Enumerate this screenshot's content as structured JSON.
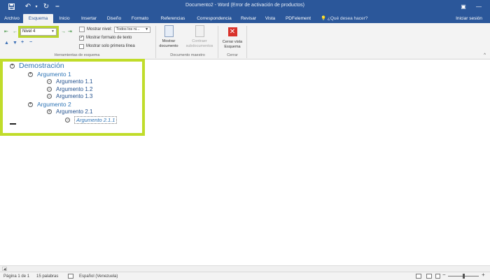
{
  "titlebar": {
    "title": "Documento2 - Word (Error de activación de productos)",
    "save_icon": "save-icon",
    "undo_icon": "undo-icon",
    "redo_icon": "redo-icon"
  },
  "tabs": [
    {
      "label": "Archivo"
    },
    {
      "label": "Esquema",
      "active": true
    },
    {
      "label": "Inicio"
    },
    {
      "label": "Insertar"
    },
    {
      "label": "Diseño"
    },
    {
      "label": "Formato"
    },
    {
      "label": "Referencias"
    },
    {
      "label": "Correspondencia"
    },
    {
      "label": "Revisar"
    },
    {
      "label": "Vista"
    },
    {
      "label": "PDFelement"
    }
  ],
  "tell_me": "¿Qué desea hacer?",
  "sign_in": "Iniciar sesión",
  "ribbon": {
    "outline_tools": {
      "level_value": "Nivel 4",
      "show_level_label": "Mostrar nivel:",
      "show_level_value": "Todos los ni...",
      "show_text_formatting": "Mostrar formato de texto",
      "show_text_formatting_checked": true,
      "show_first_line_only": "Mostrar solo primera línea",
      "show_first_line_only_checked": false,
      "group_label": "Herramientas de esquema"
    },
    "master_document": {
      "show_document": "Mostrar documento",
      "collapse_subdocuments": "Contraer subdocumentos",
      "group_label": "Documento maestro"
    },
    "close": {
      "close_outline_view": "Cerrar vista Esquema",
      "group_label": "Cerrar"
    }
  },
  "outline": {
    "items": [
      {
        "text": "Demostración",
        "symbol": "+"
      },
      {
        "text": "Argumento 1",
        "symbol": "+"
      },
      {
        "text": "Argumento 1.1",
        "symbol": "−"
      },
      {
        "text": "Argumento 1.2",
        "symbol": "−"
      },
      {
        "text": "Argumento 1.3",
        "symbol": "−"
      },
      {
        "text": "Argumento 2",
        "symbol": "+"
      },
      {
        "text": "Argumento 2.1",
        "symbol": "+"
      },
      {
        "text": "Argumento 2.1.1",
        "symbol": "−"
      }
    ]
  },
  "statusbar": {
    "page": "Página 1 de 1",
    "words": "15 palabras",
    "language": "Español (Venezuela)"
  },
  "colors": {
    "brand": "#2b579a",
    "highlight": "#c0dc2a",
    "heading": "#2e74b5"
  }
}
